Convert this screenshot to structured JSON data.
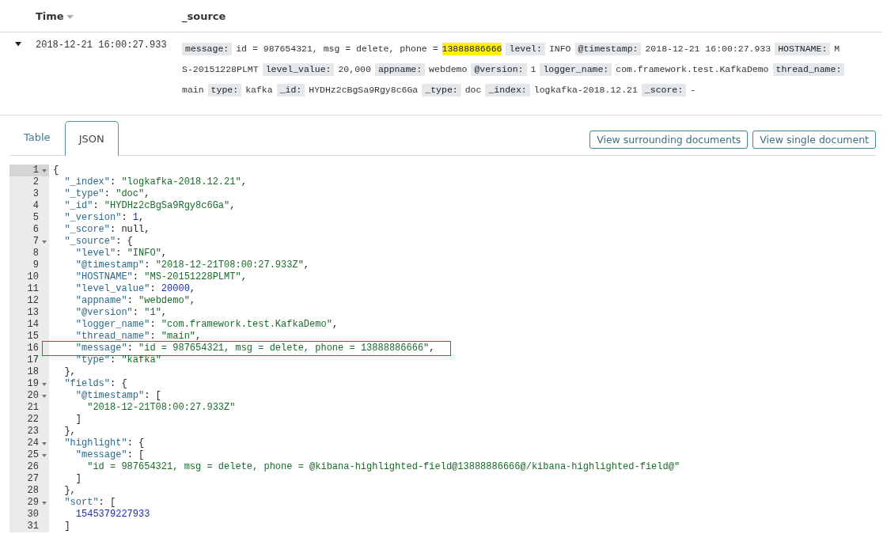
{
  "table": {
    "columns": [
      {
        "label": "Time",
        "sorted": true
      },
      {
        "label": "_source",
        "sorted": false
      }
    ],
    "row": {
      "expanded": true,
      "time": "2018-12-21 16:00:27.933",
      "source_lines": [
        [
          {
            "kind": "key",
            "text": "message:"
          },
          {
            "kind": "value",
            "text": "id = 987654321, msg = delete, phone ="
          },
          {
            "kind": "highlight",
            "text": "13888886666"
          },
          {
            "kind": "key",
            "text": "level:"
          },
          {
            "kind": "value",
            "text": "INFO"
          },
          {
            "kind": "key",
            "text": "@timestamp:"
          },
          {
            "kind": "value",
            "text": "2018-12-21 16:00:27.933"
          },
          {
            "kind": "key",
            "text": "HOSTNAME:"
          },
          {
            "kind": "value",
            "text": "M"
          }
        ],
        [
          {
            "kind": "value",
            "text": "S-20151228PLMT"
          },
          {
            "kind": "key",
            "text": "level_value:"
          },
          {
            "kind": "value",
            "text": "20,000"
          },
          {
            "kind": "key",
            "text": "appname:"
          },
          {
            "kind": "value",
            "text": "webdemo"
          },
          {
            "kind": "key",
            "text": "@version:"
          },
          {
            "kind": "value",
            "text": "1"
          },
          {
            "kind": "key",
            "text": "logger_name:"
          },
          {
            "kind": "value",
            "text": "com.framework.test.KafkaDemo"
          },
          {
            "kind": "key",
            "text": "thread_name:"
          }
        ],
        [
          {
            "kind": "value",
            "text": "main"
          },
          {
            "kind": "key",
            "text": "type:"
          },
          {
            "kind": "value",
            "text": "kafka"
          },
          {
            "kind": "key",
            "text": "_id:"
          },
          {
            "kind": "value",
            "text": "HYDHz2cBgSa9Rgy8c6Ga"
          },
          {
            "kind": "key",
            "text": "_type:"
          },
          {
            "kind": "value",
            "text": "doc"
          },
          {
            "kind": "key",
            "text": "_index:"
          },
          {
            "kind": "value",
            "text": "logkafka-2018.12.21"
          },
          {
            "kind": "key",
            "text": "_score:"
          },
          {
            "kind": "value",
            "text": "-"
          }
        ]
      ]
    }
  },
  "tabs": [
    {
      "label": "Table",
      "selected": false
    },
    {
      "label": "JSON",
      "selected": true
    }
  ],
  "buttons": [
    "View surrounding documents",
    "View single document"
  ],
  "code": [
    {
      "n": "1",
      "fold": true,
      "active": true,
      "boxed": false,
      "tokens": [
        {
          "kind": "p",
          "text": "{"
        }
      ]
    },
    {
      "n": "2",
      "fold": false,
      "active": false,
      "boxed": false,
      "tokens": [
        {
          "kind": "k",
          "text": "  \"_index\""
        },
        {
          "kind": "p",
          "text": ": "
        },
        {
          "kind": "s",
          "text": "\"logkafka-2018.12.21\""
        },
        {
          "kind": "p",
          "text": ","
        }
      ]
    },
    {
      "n": "3",
      "fold": false,
      "active": false,
      "boxed": false,
      "tokens": [
        {
          "kind": "k",
          "text": "  \"_type\""
        },
        {
          "kind": "p",
          "text": ": "
        },
        {
          "kind": "s",
          "text": "\"doc\""
        },
        {
          "kind": "p",
          "text": ","
        }
      ]
    },
    {
      "n": "4",
      "fold": false,
      "active": false,
      "boxed": false,
      "tokens": [
        {
          "kind": "k",
          "text": "  \"_id\""
        },
        {
          "kind": "p",
          "text": ": "
        },
        {
          "kind": "s",
          "text": "\"HYDHz2cBgSa9Rgy8c6Ga\""
        },
        {
          "kind": "p",
          "text": ","
        }
      ]
    },
    {
      "n": "5",
      "fold": false,
      "active": false,
      "boxed": false,
      "tokens": [
        {
          "kind": "k",
          "text": "  \"_version\""
        },
        {
          "kind": "p",
          "text": ": "
        },
        {
          "kind": "n",
          "text": "1"
        },
        {
          "kind": "p",
          "text": ","
        }
      ]
    },
    {
      "n": "6",
      "fold": false,
      "active": false,
      "boxed": false,
      "tokens": [
        {
          "kind": "k",
          "text": "  \"_score\""
        },
        {
          "kind": "p",
          "text": ": null,"
        }
      ]
    },
    {
      "n": "7",
      "fold": true,
      "active": false,
      "boxed": false,
      "tokens": [
        {
          "kind": "k",
          "text": "  \"_source\""
        },
        {
          "kind": "p",
          "text": ": {"
        }
      ]
    },
    {
      "n": "8",
      "fold": false,
      "active": false,
      "boxed": false,
      "tokens": [
        {
          "kind": "k",
          "text": "    \"level\""
        },
        {
          "kind": "p",
          "text": ": "
        },
        {
          "kind": "s",
          "text": "\"INFO\""
        },
        {
          "kind": "p",
          "text": ","
        }
      ]
    },
    {
      "n": "9",
      "fold": false,
      "active": false,
      "boxed": false,
      "tokens": [
        {
          "kind": "k",
          "text": "    \"@timestamp\""
        },
        {
          "kind": "p",
          "text": ": "
        },
        {
          "kind": "s",
          "text": "\"2018-12-21T08:00:27.933Z\""
        },
        {
          "kind": "p",
          "text": ","
        }
      ]
    },
    {
      "n": "10",
      "fold": false,
      "active": false,
      "boxed": false,
      "tokens": [
        {
          "kind": "k",
          "text": "    \"HOSTNAME\""
        },
        {
          "kind": "p",
          "text": ": "
        },
        {
          "kind": "s",
          "text": "\"MS-20151228PLMT\""
        },
        {
          "kind": "p",
          "text": ","
        }
      ]
    },
    {
      "n": "11",
      "fold": false,
      "active": false,
      "boxed": false,
      "tokens": [
        {
          "kind": "k",
          "text": "    \"level_value\""
        },
        {
          "kind": "p",
          "text": ": "
        },
        {
          "kind": "n",
          "text": "20000"
        },
        {
          "kind": "p",
          "text": ","
        }
      ]
    },
    {
      "n": "12",
      "fold": false,
      "active": false,
      "boxed": false,
      "tokens": [
        {
          "kind": "k",
          "text": "    \"appname\""
        },
        {
          "kind": "p",
          "text": ": "
        },
        {
          "kind": "s",
          "text": "\"webdemo\""
        },
        {
          "kind": "p",
          "text": ","
        }
      ]
    },
    {
      "n": "13",
      "fold": false,
      "active": false,
      "boxed": false,
      "tokens": [
        {
          "kind": "k",
          "text": "    \"@version\""
        },
        {
          "kind": "p",
          "text": ": "
        },
        {
          "kind": "s",
          "text": "\"1\""
        },
        {
          "kind": "p",
          "text": ","
        }
      ]
    },
    {
      "n": "14",
      "fold": false,
      "active": false,
      "boxed": false,
      "tokens": [
        {
          "kind": "k",
          "text": "    \"logger_name\""
        },
        {
          "kind": "p",
          "text": ": "
        },
        {
          "kind": "s",
          "text": "\"com.framework.test.KafkaDemo\""
        },
        {
          "kind": "p",
          "text": ","
        }
      ]
    },
    {
      "n": "15",
      "fold": false,
      "active": false,
      "boxed": false,
      "tokens": [
        {
          "kind": "k",
          "text": "    \"thread_name\""
        },
        {
          "kind": "p",
          "text": ": "
        },
        {
          "kind": "s",
          "text": "\"main\""
        },
        {
          "kind": "p",
          "text": ","
        }
      ]
    },
    {
      "n": "16",
      "fold": false,
      "active": false,
      "boxed": true,
      "tokens": [
        {
          "kind": "k",
          "text": "    \"message\""
        },
        {
          "kind": "p",
          "text": ": "
        },
        {
          "kind": "s",
          "text": "\"id = 987654321, msg = delete, phone = 13888886666\""
        },
        {
          "kind": "p",
          "text": ","
        }
      ]
    },
    {
      "n": "17",
      "fold": false,
      "active": false,
      "boxed": false,
      "tokens": [
        {
          "kind": "k",
          "text": "    \"type\""
        },
        {
          "kind": "p",
          "text": ": "
        },
        {
          "kind": "s",
          "text": "\"kafka\""
        }
      ]
    },
    {
      "n": "18",
      "fold": false,
      "active": false,
      "boxed": false,
      "tokens": [
        {
          "kind": "p",
          "text": "  },"
        }
      ]
    },
    {
      "n": "19",
      "fold": true,
      "active": false,
      "boxed": false,
      "tokens": [
        {
          "kind": "k",
          "text": "  \"fields\""
        },
        {
          "kind": "p",
          "text": ": {"
        }
      ]
    },
    {
      "n": "20",
      "fold": true,
      "active": false,
      "boxed": false,
      "tokens": [
        {
          "kind": "k",
          "text": "    \"@timestamp\""
        },
        {
          "kind": "p",
          "text": ": ["
        }
      ]
    },
    {
      "n": "21",
      "fold": false,
      "active": false,
      "boxed": false,
      "tokens": [
        {
          "kind": "s",
          "text": "      \"2018-12-21T08:00:27.933Z\""
        }
      ]
    },
    {
      "n": "22",
      "fold": false,
      "active": false,
      "boxed": false,
      "tokens": [
        {
          "kind": "p",
          "text": "    ]"
        }
      ]
    },
    {
      "n": "23",
      "fold": false,
      "active": false,
      "boxed": false,
      "tokens": [
        {
          "kind": "p",
          "text": "  },"
        }
      ]
    },
    {
      "n": "24",
      "fold": true,
      "active": false,
      "boxed": false,
      "tokens": [
        {
          "kind": "k",
          "text": "  \"highlight\""
        },
        {
          "kind": "p",
          "text": ": {"
        }
      ]
    },
    {
      "n": "25",
      "fold": true,
      "active": false,
      "boxed": false,
      "tokens": [
        {
          "kind": "k",
          "text": "    \"message\""
        },
        {
          "kind": "p",
          "text": ": ["
        }
      ]
    },
    {
      "n": "26",
      "fold": false,
      "active": false,
      "boxed": false,
      "tokens": [
        {
          "kind": "s",
          "text": "      \"id = 987654321, msg = delete, phone = @kibana-highlighted-field@13888886666@/kibana-highlighted-field@\""
        }
      ]
    },
    {
      "n": "27",
      "fold": false,
      "active": false,
      "boxed": false,
      "tokens": [
        {
          "kind": "p",
          "text": "    ]"
        }
      ]
    },
    {
      "n": "28",
      "fold": false,
      "active": false,
      "boxed": false,
      "tokens": [
        {
          "kind": "p",
          "text": "  },"
        }
      ]
    },
    {
      "n": "29",
      "fold": true,
      "active": false,
      "boxed": false,
      "tokens": [
        {
          "kind": "k",
          "text": "  \"sort\""
        },
        {
          "kind": "p",
          "text": ": ["
        }
      ]
    },
    {
      "n": "30",
      "fold": false,
      "active": false,
      "boxed": false,
      "tokens": [
        {
          "kind": "n",
          "text": "    1545379227933"
        }
      ]
    },
    {
      "n": "31",
      "fold": false,
      "active": false,
      "boxed": false,
      "tokens": [
        {
          "kind": "p",
          "text": "  ]"
        }
      ]
    }
  ]
}
